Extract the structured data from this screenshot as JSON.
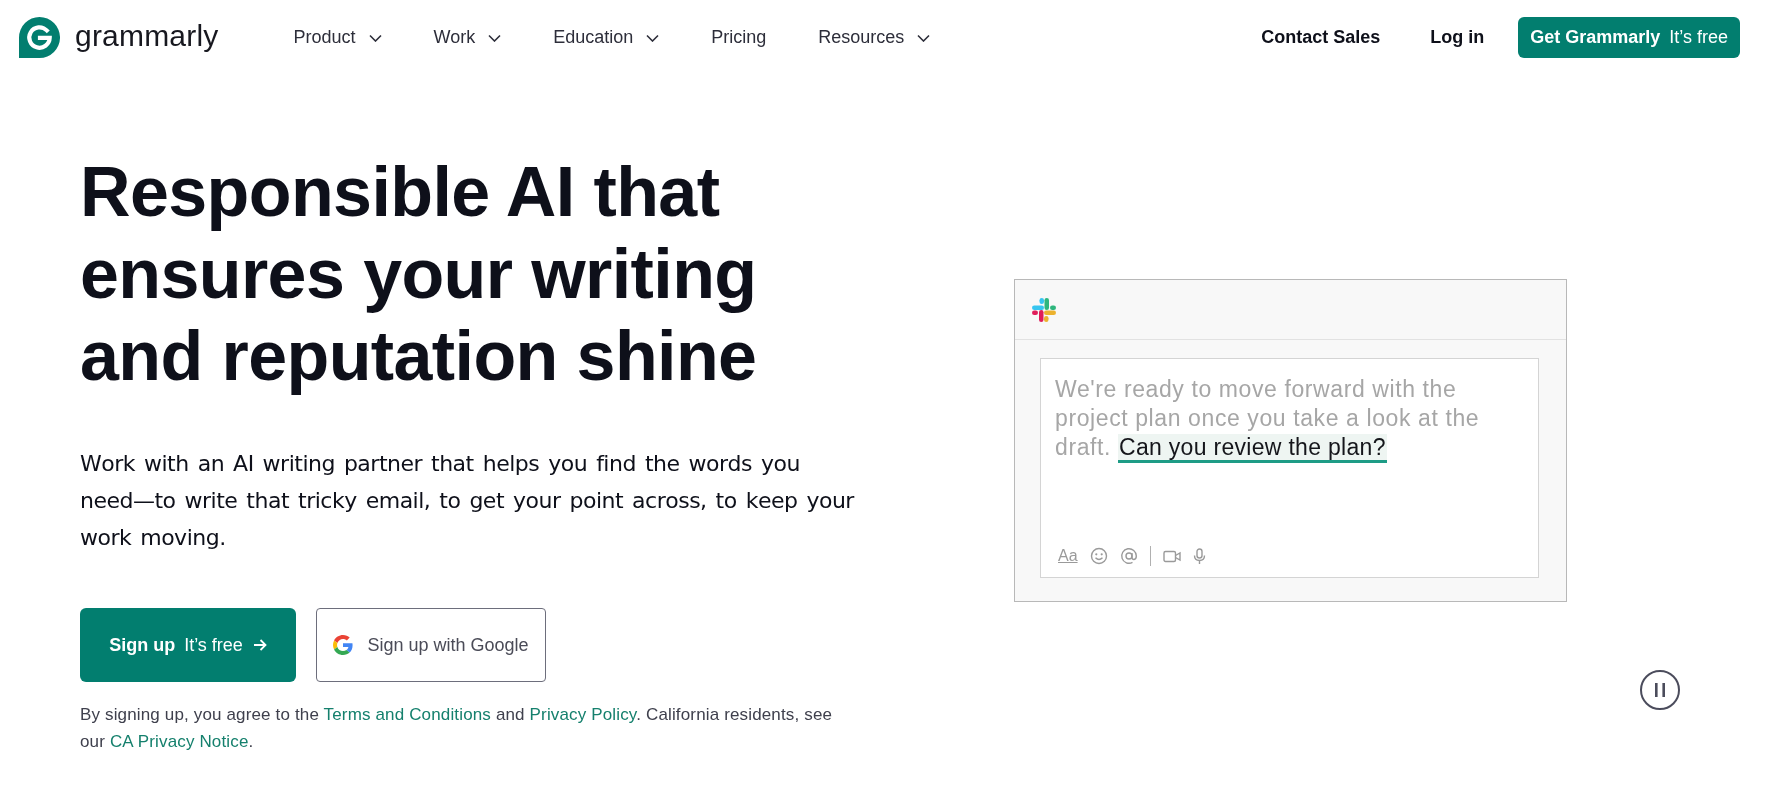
{
  "header": {
    "logo": "grammarly",
    "nav": [
      {
        "label": "Product",
        "kind": "menu"
      },
      {
        "label": "Work",
        "kind": "menu"
      },
      {
        "label": "Education",
        "kind": "menu"
      },
      {
        "label": "Pricing",
        "kind": "link"
      },
      {
        "label": "Resources",
        "kind": "menu"
      }
    ],
    "actions": [
      {
        "label": "Contact Sales",
        "kind": "link"
      },
      {
        "label": "Log in",
        "kind": "link"
      },
      {
        "label": "**Get Grammarly** It’s free",
        "kind": "button"
      }
    ]
  },
  "hero": {
    "heading": "Responsible AI that ensures your writing and reputation shine",
    "description": "Work with an AI writing partner that helps you find the words you need—to write that tricky email, to get your point across, to keep your work moving.",
    "buttons": [
      {
        "label": "**Sign up** It’s free",
        "kind": "primary"
      },
      {
        "label": "Sign up with Google",
        "kind": "google"
      }
    ],
    "legal": [
      {
        "kind": "text",
        "text": "By signing up, you agree to the "
      },
      {
        "kind": "link",
        "text": "Terms and Conditions"
      },
      {
        "kind": "text",
        "text": " and "
      },
      {
        "kind": "link",
        "text": "Privacy Policy"
      },
      {
        "kind": "text",
        "text": ". California residents, see our "
      },
      {
        "kind": "link",
        "text": "CA Privacy Notice"
      },
      {
        "kind": "text",
        "text": "."
      }
    ]
  },
  "demo": {
    "message": "We're ready to move forward with the project plan once you take a look at the draft.",
    "suggestion": "Can you review the plan?",
    "format_label": "Aa"
  }
}
